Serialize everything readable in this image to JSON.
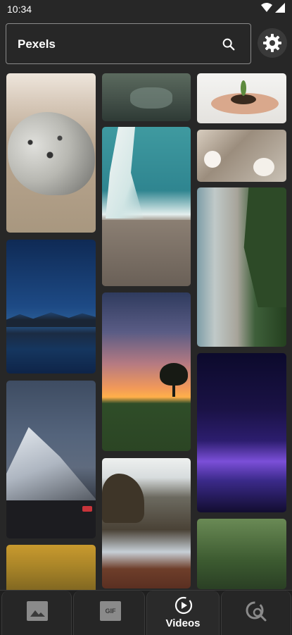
{
  "status_bar": {
    "time": "10:34"
  },
  "search": {
    "label": "Pexels"
  },
  "grid": {
    "tiles": [
      {
        "name": "seal-photo",
        "col": 0
      },
      {
        "name": "mountain-lake-photo",
        "col": 0
      },
      {
        "name": "snowy-peak-stars-photo",
        "col": 0
      },
      {
        "name": "autumn-trees-photo",
        "col": 0
      },
      {
        "name": "river-rocks-photo",
        "col": 1
      },
      {
        "name": "aerial-surf-rocks-photo",
        "col": 1
      },
      {
        "name": "sunset-tree-photo",
        "col": 1
      },
      {
        "name": "coast-rocks-photo",
        "col": 1
      },
      {
        "name": "hands-plant-photo",
        "col": 2
      },
      {
        "name": "blossoms-photo",
        "col": 2
      },
      {
        "name": "aerial-beach-photo",
        "col": 2
      },
      {
        "name": "purple-particles-photo",
        "col": 2
      },
      {
        "name": "forest-photo",
        "col": 2
      }
    ]
  },
  "bottom_nav": {
    "tabs": [
      {
        "id": "photos",
        "icon": "image-icon",
        "label": ""
      },
      {
        "id": "gif",
        "icon": "gif-icon",
        "icon_text": "GIF",
        "label": ""
      },
      {
        "id": "videos",
        "icon": "play-circle-icon",
        "label": "Videos",
        "selected": true
      },
      {
        "id": "search",
        "icon": "image-search-icon",
        "label": ""
      }
    ]
  },
  "colors": {
    "background": "#272727",
    "nav": "#1f1f1f",
    "text": "#ffffff",
    "muted_icon": "#8a8a8a"
  }
}
